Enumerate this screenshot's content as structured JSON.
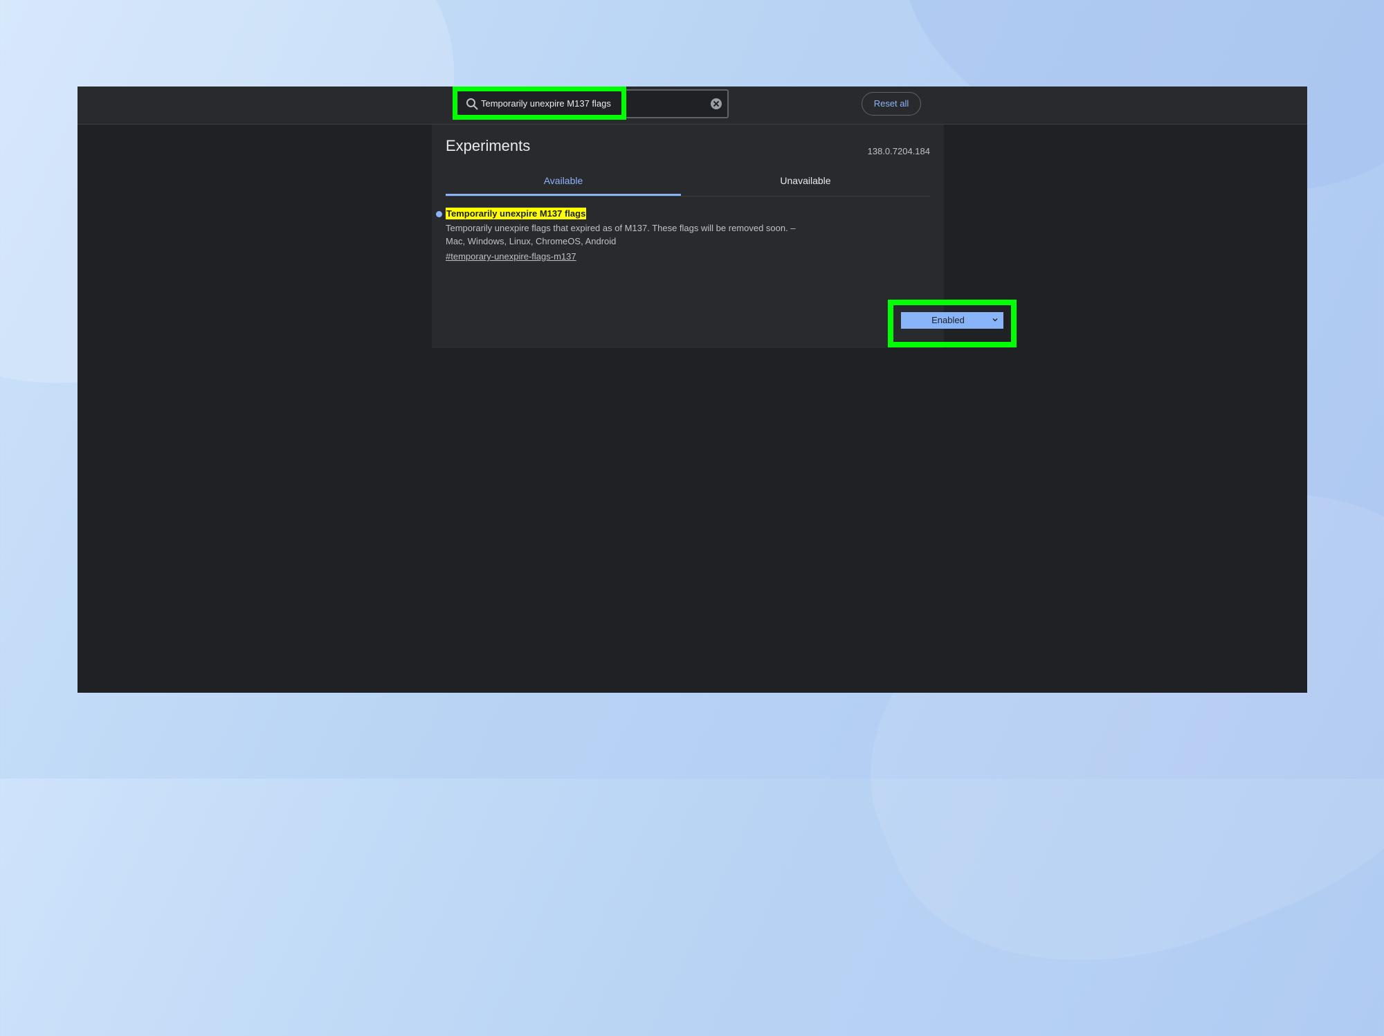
{
  "search": {
    "value": "Temporarily unexpire M137 flags"
  },
  "header": {
    "reset_label": "Reset all"
  },
  "page": {
    "title": "Experiments",
    "version": "138.0.7204.184"
  },
  "tabs": [
    {
      "label": "Available",
      "active": true
    },
    {
      "label": "Unavailable",
      "active": false
    }
  ],
  "experiment": {
    "name": "Temporarily unexpire M137 flags",
    "name_suffix": ".",
    "description": "Temporarily unexpire flags that expired as of M137. These flags will be removed soon. –",
    "platforms": "Mac, Windows, Linux, ChromeOS, Android",
    "link": "#temporary-unexpire-flags-m137",
    "state": "Enabled"
  },
  "colors": {
    "accent": "#8ab4f8",
    "highlight_box": "#00ff00",
    "search_match": "#ffff00",
    "background": "#202124"
  }
}
